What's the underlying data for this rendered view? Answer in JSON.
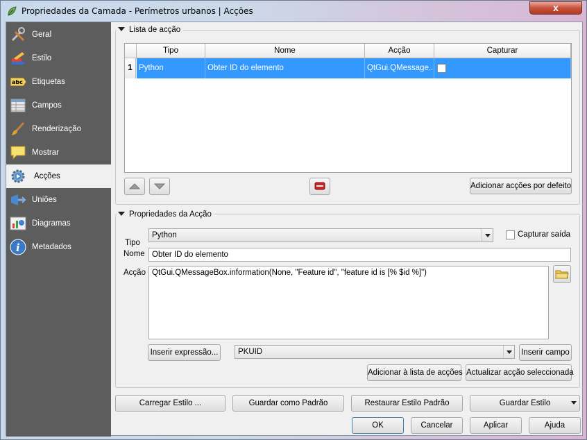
{
  "window": {
    "title": "Propriedades da Camada - Perímetros urbanos | Acções",
    "close_glyph": "x"
  },
  "sidebar": {
    "items": [
      {
        "label": "Geral",
        "icon": "tools-icon"
      },
      {
        "label": "Estilo",
        "icon": "paint-icon"
      },
      {
        "label": "Etiquetas",
        "icon": "labels-icon"
      },
      {
        "label": "Campos",
        "icon": "table-icon"
      },
      {
        "label": "Renderização",
        "icon": "brush-icon"
      },
      {
        "label": "Mostrar",
        "icon": "speech-bubble-icon"
      },
      {
        "label": "Acções",
        "icon": "gear-play-icon",
        "active": true
      },
      {
        "label": "Uniões",
        "icon": "join-icon"
      },
      {
        "label": "Diagramas",
        "icon": "diagram-icon"
      },
      {
        "label": "Metadados",
        "icon": "info-icon"
      }
    ]
  },
  "action_list": {
    "title": "Lista de acção",
    "columns": [
      "Tipo",
      "Nome",
      "Acção",
      "Capturar"
    ],
    "rows": [
      {
        "index": "1",
        "tipo": "Python",
        "nome": "Obter ID do elemento",
        "accao": "QtGui.QMessage...",
        "capturar": false
      }
    ],
    "add_default_label": "Adicionar acções por defeito"
  },
  "properties": {
    "title": "Propriedades da Acção",
    "tipo_label": "Tipo",
    "tipo_value": "Python",
    "capture_label": "Capturar saída",
    "nome_label": "Nome",
    "nome_value": "Obter ID do elemento",
    "accao_label": "Acção",
    "accao_value": "QtGui.QMessageBox.information(None, \"Feature id\", \"feature id is [% $id %]\")",
    "insert_expr_label": "Inserir expressão...",
    "field_value": "PKUID",
    "insert_field_label": "Inserir campo",
    "add_to_list_label": "Adicionar à lista de acções",
    "update_label": "Actualizar acção seleccionada"
  },
  "footer": {
    "load_style": "Carregar Estilo ...",
    "save_default": "Guardar como Padrão",
    "restore_default": "Restaurar Estilo Padrão",
    "save_style": "Guardar Estilo",
    "ok": "OK",
    "cancel": "Cancelar",
    "apply": "Aplicar",
    "help": "Ajuda"
  },
  "colors": {
    "sidebar_bg": "#5d5d5d",
    "selection": "#3399ff"
  }
}
